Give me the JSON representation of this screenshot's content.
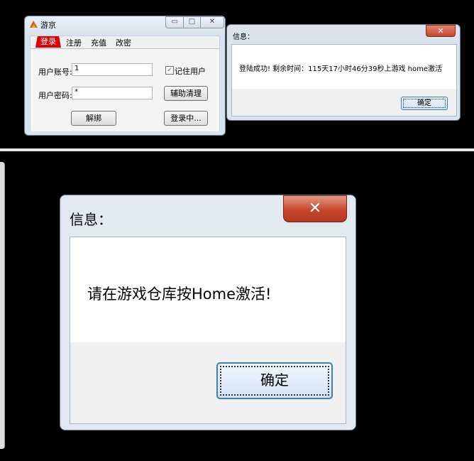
{
  "login_window": {
    "title": "游京",
    "minimize_glyph": "▭",
    "maximize_glyph": "□",
    "close_glyph": "✕",
    "tabs": [
      {
        "label": "登录"
      },
      {
        "label": "注册"
      },
      {
        "label": "充值"
      },
      {
        "label": "改密"
      }
    ],
    "account_label": "用户账号:",
    "account_value": "1",
    "password_label": "用户密码:",
    "password_value": "*",
    "remember_label": "记住用户",
    "remember_check": "✓",
    "assist_button": "辅助清理",
    "unbind_button": "解绑",
    "login_button": "登录中..."
  },
  "small_dialog": {
    "title": "信息：",
    "close_glyph": "✕",
    "message": "登陆成功! 剩余时间：115天17小时46分39秒上游戏 home激活",
    "ok_button": "确定"
  },
  "large_dialog": {
    "title": "信息：",
    "close_glyph": "✕",
    "message": "请在游戏仓库按Home激活!",
    "ok_button": "确定"
  },
  "colors": {
    "active_tab": "#e00000",
    "close_button": "#c8452c",
    "background": "#000000"
  }
}
